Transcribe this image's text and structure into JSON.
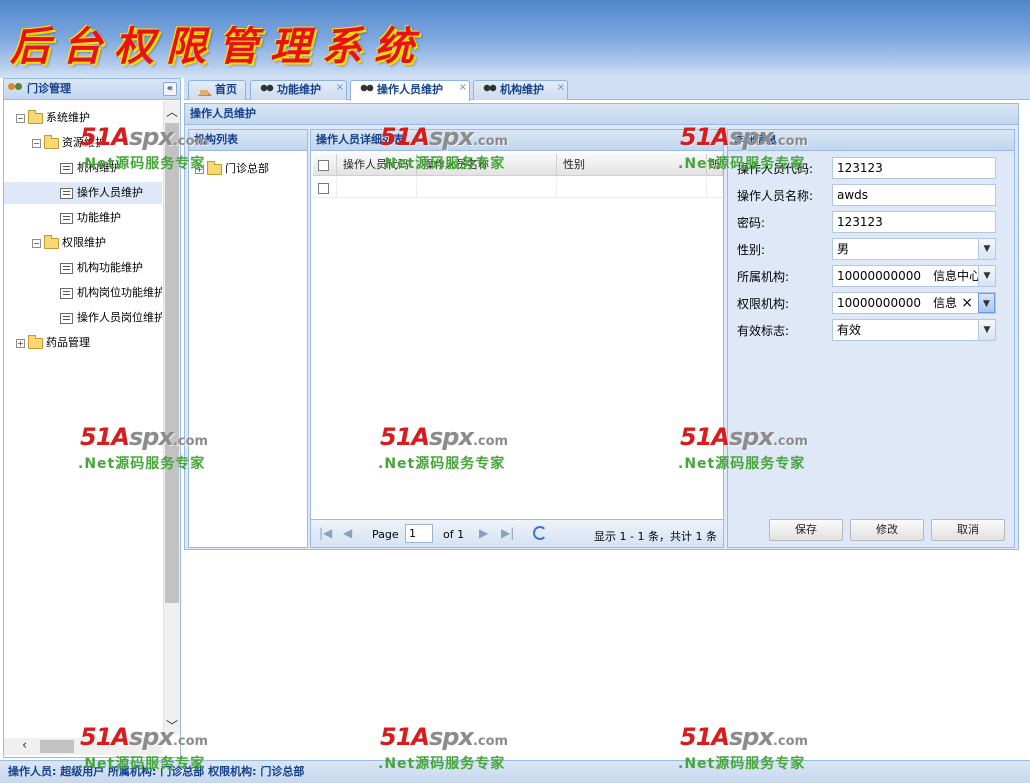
{
  "header": {
    "title": "后台权限管理系统"
  },
  "left_panel": {
    "title": "门诊管理",
    "collapse_glyph": "«",
    "tree": [
      {
        "label": "系统维护",
        "level": 0,
        "expander": "−",
        "type": "folder"
      },
      {
        "label": "资源维护",
        "level": 1,
        "expander": "−",
        "type": "folder"
      },
      {
        "label": "机构维护",
        "level": 2,
        "type": "leaf"
      },
      {
        "label": "操作人员维护",
        "level": 2,
        "type": "leaf",
        "selected": true
      },
      {
        "label": "功能维护",
        "level": 2,
        "type": "leaf"
      },
      {
        "label": "权限维护",
        "level": 1,
        "expander": "−",
        "type": "folder"
      },
      {
        "label": "机构功能维护",
        "level": 2,
        "type": "leaf"
      },
      {
        "label": "机构岗位功能维护",
        "level": 2,
        "type": "leaf"
      },
      {
        "label": "操作人员岗位维护",
        "level": 2,
        "type": "leaf"
      },
      {
        "label": "药品管理",
        "level": 0,
        "expander": "+",
        "type": "folder"
      }
    ]
  },
  "tabs": [
    {
      "label": "首页",
      "icon": "home-icon",
      "closable": false
    },
    {
      "label": "功能维护",
      "icon": "people-icon",
      "closable": true
    },
    {
      "label": "操作人员维护",
      "icon": "people-icon",
      "closable": true,
      "active": true
    },
    {
      "label": "机构维护",
      "icon": "people-icon",
      "closable": true
    }
  ],
  "tab_close_glyph": "×",
  "main": {
    "title": "操作人员维护",
    "org_panel": {
      "title": "机构列表",
      "root": "门诊总部",
      "expander": "+"
    },
    "grid_panel": {
      "title": "操作人员详细列表",
      "columns": [
        "操作人员代码",
        "操作人员名称",
        "性别",
        "所"
      ],
      "pager": {
        "page_label": "Page",
        "page_value": "1",
        "of_label": "of 1",
        "display": "显示 1 - 1 条，共计 1 条"
      }
    },
    "form_panel": {
      "title": "详细信息",
      "fields": [
        {
          "label": "操作人员代码:",
          "value": "123123"
        },
        {
          "label": "操作人员名称:",
          "value": "awds"
        },
        {
          "label": "密码:",
          "value": "123123"
        },
        {
          "label": "性别:",
          "value": "男"
        },
        {
          "label": "所属机构:",
          "value": "10000000000",
          "value2": "信息中心"
        },
        {
          "label": "权限机构:",
          "value": "10000000000",
          "value2": "信息"
        },
        {
          "label": "有效标志:",
          "value": "有效"
        }
      ],
      "clear_glyph": "×",
      "buttons": {
        "save": "保存",
        "edit": "修改",
        "cancel": "取消"
      }
    }
  },
  "statusbar": "操作人员: 超级用户   所属机构: 门诊总部   权限机构: 门诊总部",
  "watermark": {
    "logo_a": "51A",
    "logo_b": "spx",
    "domain": ".com",
    "tagline": ".Net源码服务专家"
  },
  "colors": {
    "accent": "#15428b",
    "border": "#99bbe8",
    "title_red": "#e8111a",
    "watermark_red": "#d81c1c",
    "watermark_green": "#46a63a"
  }
}
